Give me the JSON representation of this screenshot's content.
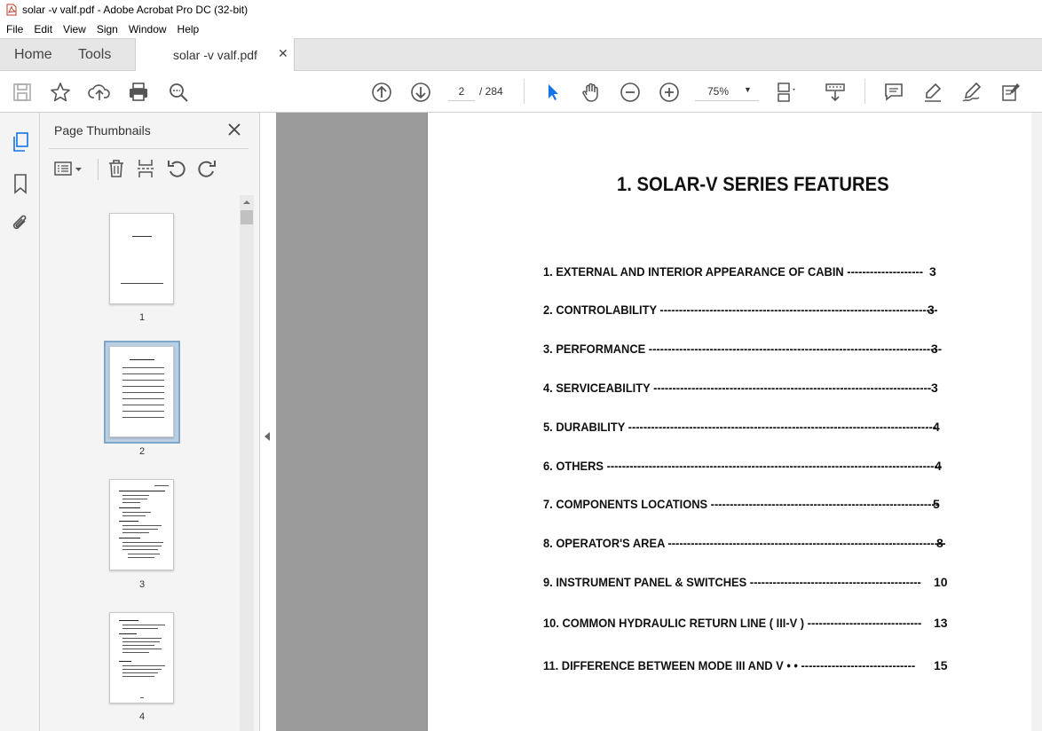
{
  "window": {
    "title": "solar -v valf.pdf - Adobe Acrobat Pro DC (32-bit)"
  },
  "menu": [
    "File",
    "Edit",
    "View",
    "Sign",
    "Window",
    "Help"
  ],
  "tabs": {
    "home": "Home",
    "tools": "Tools",
    "document": "solar -v valf.pdf"
  },
  "toolbar": {
    "current_page": "2",
    "page_total": "/ 284",
    "zoom": "75%"
  },
  "thumbnails_panel": {
    "title": "Page Thumbnails",
    "pages": [
      "1",
      "2",
      "3",
      "4"
    ],
    "selected_page": "2"
  },
  "document": {
    "heading": "1. SOLAR-V SERIES FEATURES",
    "toc": [
      {
        "label": "1. EXTERNAL AND INTERIOR APPEARANCE OF CABIN --------------------",
        "page": "3"
      },
      {
        "label": "2. CONTROLABILITY -------------------------------------------------------------------------",
        "page": "3"
      },
      {
        "label": "3. PERFORMANCE -----------------------------------------------------------------------------",
        "page": "3"
      },
      {
        "label": "4. SERVICEABILITY -------------------------------------------------------------------------",
        "page": "3"
      },
      {
        "label": "5. DURABILITY ---------------------------------------------------------------------------------",
        "page": "4"
      },
      {
        "label": "6. OTHERS ----------------------------------------------------------------------------------------",
        "page": "4"
      },
      {
        "label": "7. COMPONENTS LOCATIONS ------------------------------------------------------------",
        "page": "5"
      },
      {
        "label": "8. OPERATOR'S AREA -------------------------------------------------------------------------",
        "page": "8"
      },
      {
        "label": "9. INSTRUMENT PANEL & SWITCHES ---------------------------------------------",
        "page": "10"
      },
      {
        "label": "10. COMMON HYDRAULIC RETURN LINE ( III-V ) ------------------------------",
        "page": "13"
      },
      {
        "label": "11. DIFFERENCE BETWEEN MODE III AND  V • • ------------------------------",
        "page": "15"
      }
    ]
  },
  "colors": {
    "accent": "#1473e6",
    "tab_bar": "#e6e6e6",
    "doc_gray": "#9b9b9b",
    "thumb_selected": "#b9cfe2"
  },
  "icons": {
    "toolbar": [
      "save-icon",
      "star-icon",
      "upload-cloud-icon",
      "print-icon",
      "search-zoom-icon",
      "prev-page-icon",
      "next-page-icon",
      "select-arrow-icon",
      "hand-icon",
      "zoom-out-icon",
      "zoom-in-icon",
      "page-layout-icon",
      "scroll-mode-icon",
      "comment-icon",
      "highlight-pen-icon",
      "draw-icon",
      "fill-sign-icon"
    ],
    "left_strip": [
      "page-thumbnails-icon",
      "bookmark-icon",
      "attachment-icon"
    ],
    "panel_tools": [
      "options-menu-icon",
      "delete-icon",
      "insert-page-icon",
      "rotate-left-icon",
      "rotate-right-icon"
    ]
  }
}
